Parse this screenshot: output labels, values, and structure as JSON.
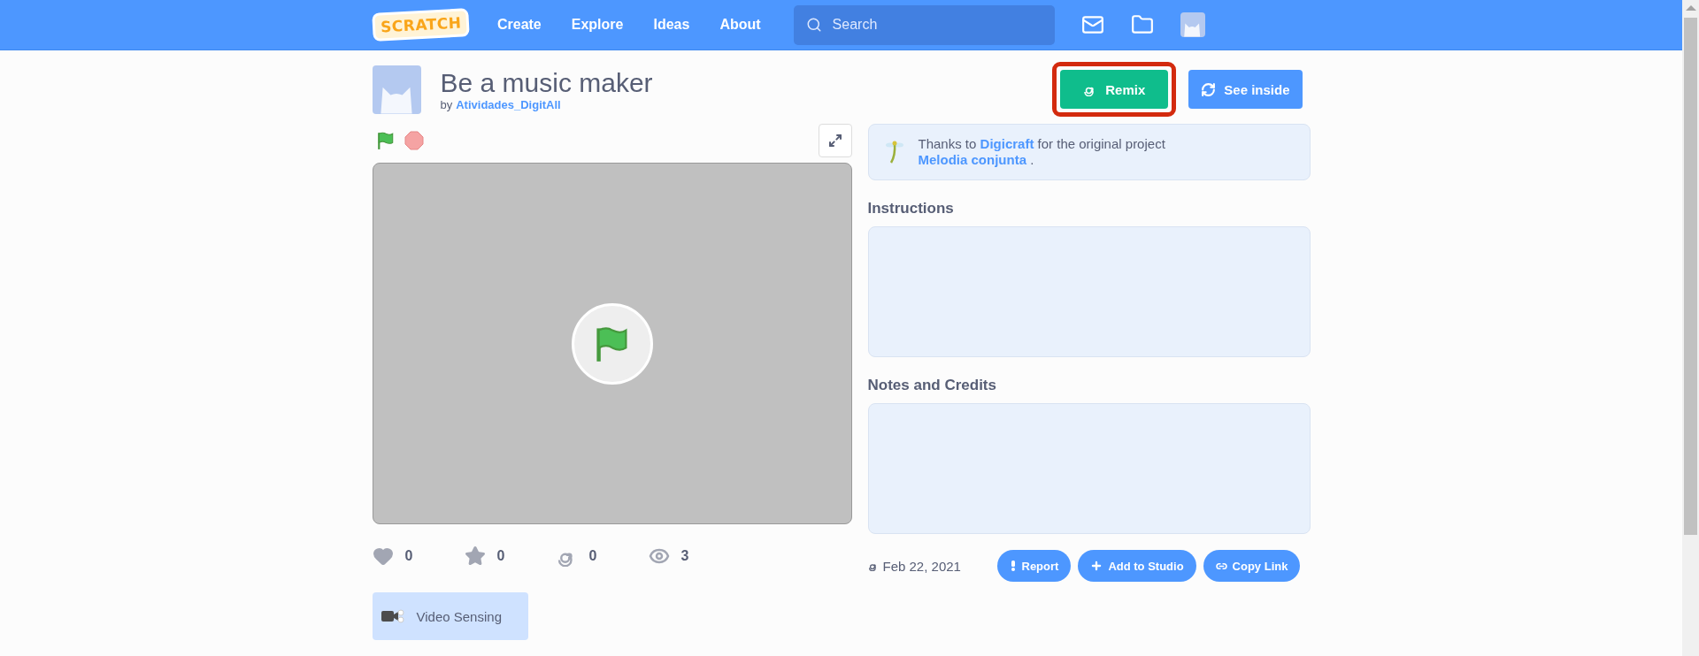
{
  "header": {
    "logo": "SCRATCH",
    "nav": [
      "Create",
      "Explore",
      "Ideas",
      "About"
    ],
    "search": {
      "placeholder": "Search"
    }
  },
  "project": {
    "title": "Be a music maker",
    "by": "by",
    "author": "Atividades_DigitAll"
  },
  "buttons": [
    {
      "kind": "remix",
      "label": "Remix",
      "highlighted": true
    },
    {
      "kind": "see-inside",
      "label": "See inside",
      "highlighted": false
    }
  ],
  "credit": [
    {
      "kind": "text",
      "text": "Thanks to"
    },
    {
      "kind": "link",
      "text": "Digicraft"
    },
    {
      "kind": "text",
      "text": "for the original project"
    },
    {
      "kind": "link",
      "text": "Melodia conjunta"
    },
    {
      "kind": "text",
      "text": "."
    }
  ],
  "sections": [
    {
      "heading": "Instructions"
    },
    {
      "heading": "Notes and Credits"
    }
  ],
  "stats": [
    {
      "kind": "love",
      "count": "0"
    },
    {
      "kind": "favorite",
      "count": "0"
    },
    {
      "kind": "remix",
      "count": "0"
    },
    {
      "kind": "view",
      "count": "3"
    }
  ],
  "date": "Feb 22, 2021",
  "actions": [
    {
      "kind": "report",
      "label": "Report"
    },
    {
      "kind": "studio",
      "label": "Add to Studio"
    },
    {
      "kind": "link",
      "label": "Copy Link"
    }
  ],
  "extensions": [
    {
      "kind": "video",
      "label": "Video Sensing"
    }
  ]
}
